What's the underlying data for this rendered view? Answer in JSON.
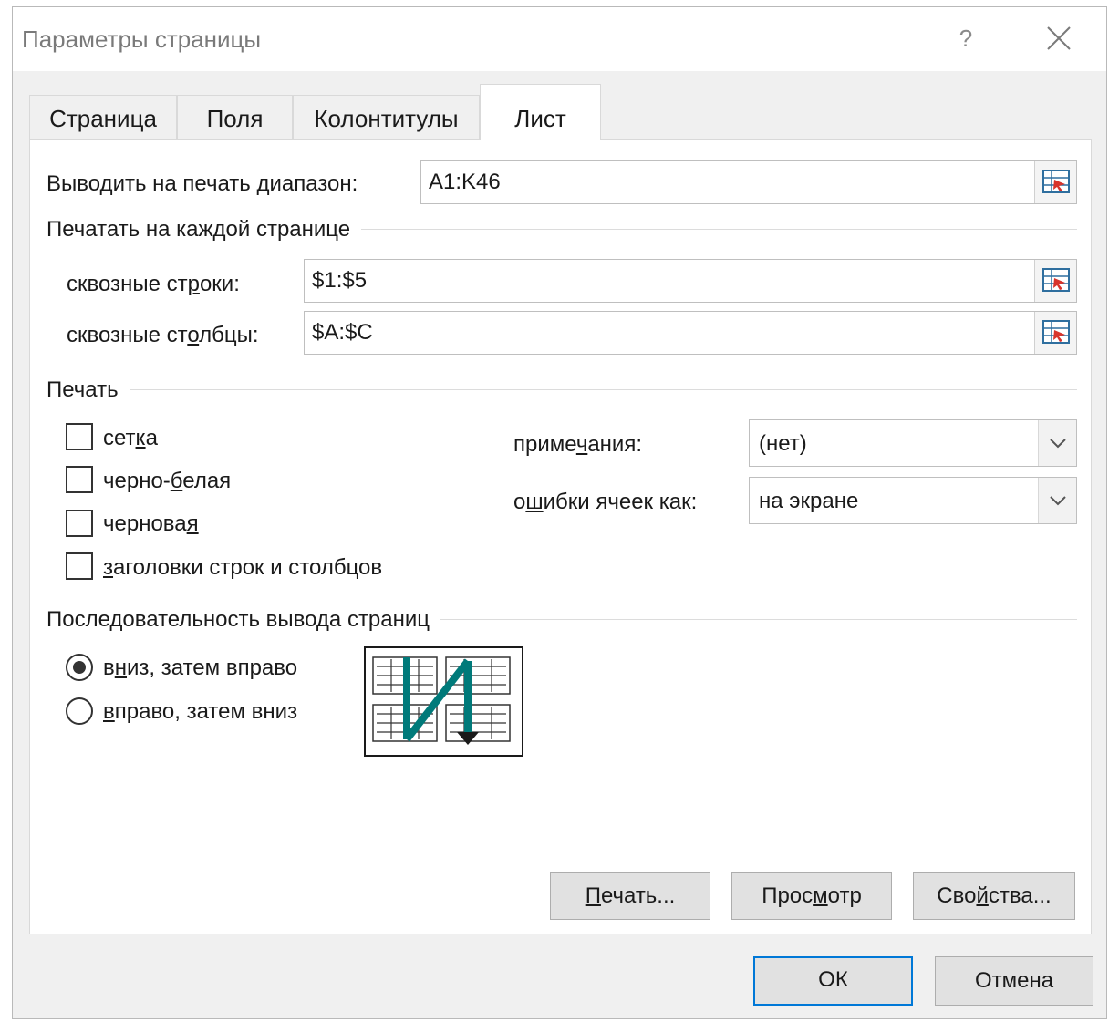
{
  "window": {
    "title": "Параметры страницы",
    "help_label": "?",
    "close_icon": "close-icon"
  },
  "tabs": [
    {
      "label": "Страница",
      "active": false
    },
    {
      "label": "Поля",
      "active": false
    },
    {
      "label": "Колонтитулы",
      "active": false
    },
    {
      "label": "Лист",
      "active": true
    }
  ],
  "print_area": {
    "label_pre": "Выводить на печать ",
    "label_ul": "д",
    "label_post": "иапазон:",
    "value": "A1:K46"
  },
  "print_titles": {
    "group_label": "Печатать на каждой странице",
    "rows": {
      "label_pre": "сквозные ст",
      "label_ul": "р",
      "label_post": "оки:",
      "value": "$1:$5"
    },
    "cols": {
      "label_pre": "сквозные ст",
      "label_ul": "о",
      "label_post": "лбцы:",
      "value": "$A:$C"
    }
  },
  "print": {
    "group_label": "Печать",
    "checkboxes": [
      {
        "pre": "сет",
        "ul": "к",
        "post": "а",
        "checked": false
      },
      {
        "pre": "черно-",
        "ul": "б",
        "post": "елая",
        "checked": false
      },
      {
        "pre": "чернова",
        "ul": "я",
        "post": "",
        "checked": false
      },
      {
        "pre": "",
        "ul": "з",
        "post": "аголовки строк и столбцов",
        "checked": false
      }
    ],
    "comments": {
      "label_pre": "приме",
      "label_ul": "ч",
      "label_post": "ания:",
      "value": "(нет)"
    },
    "errors": {
      "label_pre": "о",
      "label_ul": "ш",
      "label_post": "ибки ячеек как:",
      "value": "на экране"
    }
  },
  "page_order": {
    "group_label": "Последовательность вывода страниц",
    "options": [
      {
        "pre": "в",
        "ul": "н",
        "post": "из, затем вправо",
        "selected": true
      },
      {
        "pre": "",
        "ul": "в",
        "post": "право, затем вниз",
        "selected": false
      }
    ],
    "arrow_color": "#007a7a"
  },
  "buttons": {
    "print": {
      "pre": "",
      "ul": "П",
      "post": "ечать..."
    },
    "preview": {
      "pre": "Прос",
      "ul": "м",
      "post": "отр"
    },
    "properties": {
      "pre": "Сво",
      "ul": "й",
      "post": "ства..."
    },
    "ok": "ОК",
    "cancel": "Отмена"
  }
}
